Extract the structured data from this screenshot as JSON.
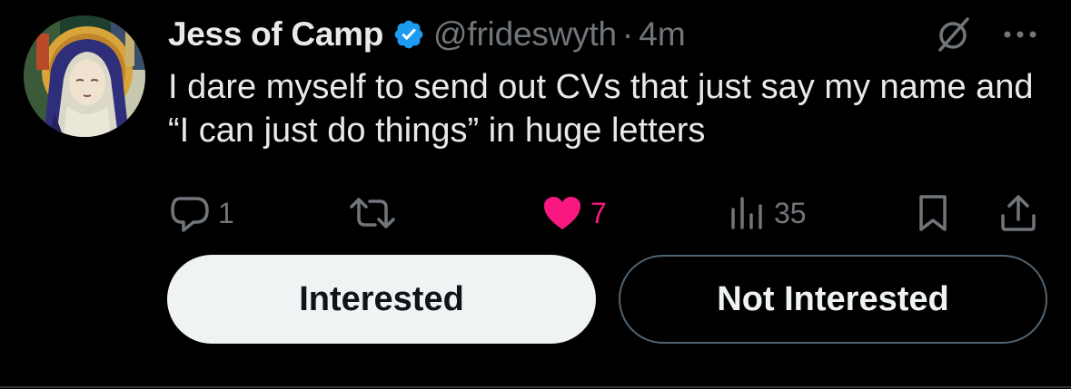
{
  "tweet": {
    "author": {
      "display_name": "Jess of Camp",
      "handle": "@frideswyth",
      "verified": true
    },
    "separator": "·",
    "timestamp": "4m",
    "text": "I dare myself to send out CVs that just say my name and “I can just do things” in huge letters",
    "actions": {
      "reply_count": "1",
      "retweet_count": "",
      "like_count": "7",
      "view_count": "35"
    },
    "icons": {
      "reply": "speech-bubble-icon",
      "retweet": "retweet-arrows-icon",
      "like": "heart-icon",
      "views": "bar-chart-icon",
      "bookmark": "bookmark-icon",
      "share": "share-upload-icon",
      "grok": "grok-slash-icon",
      "more": "ellipsis-icon"
    }
  },
  "prompt": {
    "interested_label": "Interested",
    "not_interested_label": "Not Interested"
  },
  "colors": {
    "background": "#000000",
    "text_primary": "#e7e9ea",
    "text_secondary": "#71767b",
    "verified_blue": "#1d9bf0",
    "like_pink": "#f91880",
    "button_light": "#eff3f4",
    "button_border": "#536471"
  }
}
